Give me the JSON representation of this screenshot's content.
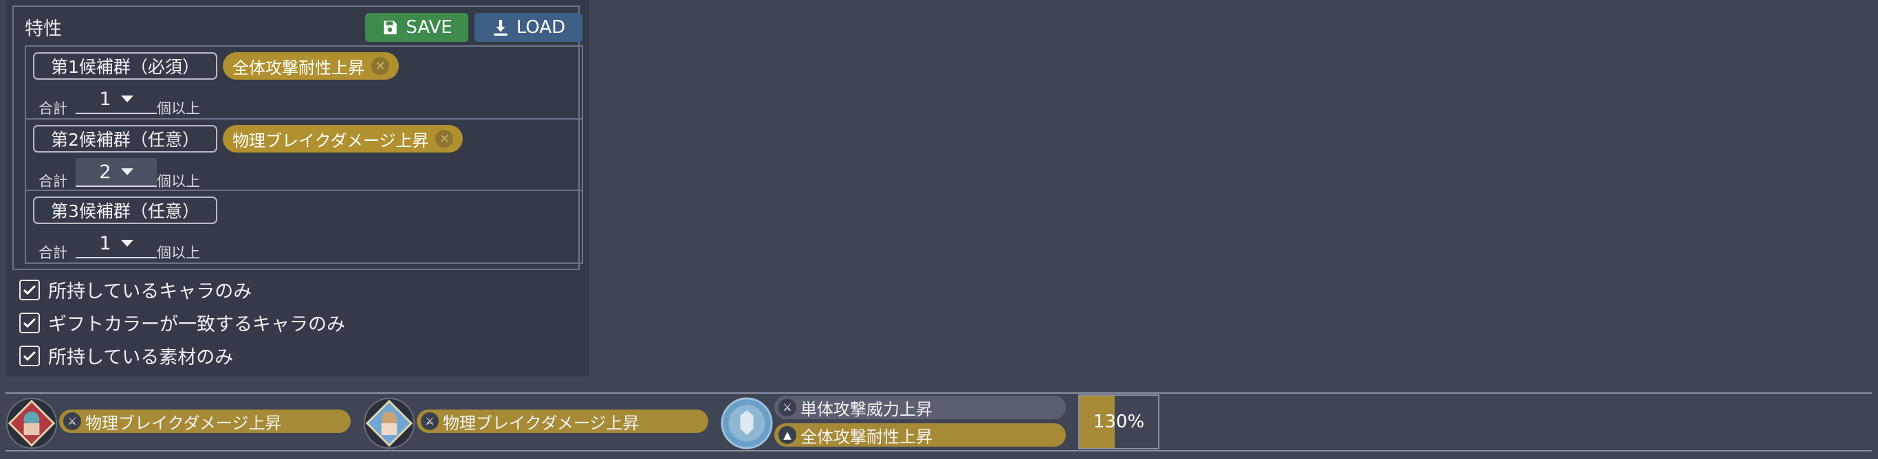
{
  "panel": {
    "title": "特性",
    "save_label": "SAVE",
    "load_label": "LOAD",
    "groups": [
      {
        "label": "第1候補群（必須）",
        "chip": "全体攻撃耐性上昇",
        "sum_prefix": "合計",
        "count": "1",
        "sum_suffix": "個以上"
      },
      {
        "label": "第2候補群（任意）",
        "chip": "物理ブレイクダメージ上昇",
        "sum_prefix": "合計",
        "count": "2",
        "sum_suffix": "個以上"
      },
      {
        "label": "第3候補群（任意）",
        "sum_prefix": "合計",
        "count": "1",
        "sum_suffix": "個以上"
      }
    ]
  },
  "filters": [
    {
      "label": "所持しているキャラのみ",
      "checked": true
    },
    {
      "label": "ギフトカラーが一致するキャラのみ",
      "checked": true
    },
    {
      "label": "所持している素材のみ",
      "checked": true
    }
  ],
  "result": {
    "cards": [
      {
        "trait": "物理ブレイクダメージ上昇"
      },
      {
        "trait": "物理ブレイクダメージ上昇"
      },
      {
        "traits": [
          "単体攻撃威力上昇",
          "全体攻撃耐性上昇"
        ]
      }
    ],
    "percent_label": "130%",
    "percent_fill": 0.45
  },
  "colors": {
    "save": "#3f8a4d",
    "load": "#3e5f86",
    "chip": "#b0902f",
    "gold": "#a68a35"
  }
}
